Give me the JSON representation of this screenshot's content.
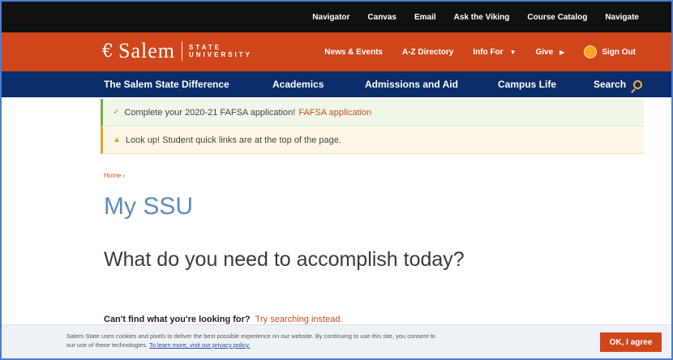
{
  "utility_nav": [
    "Navigator",
    "Canvas",
    "Email",
    "Ask the Viking",
    "Course Catalog",
    "Navigate"
  ],
  "brand": {
    "logo_mark": "€",
    "logo_word": "Salem",
    "logo_sub_top": "STATE",
    "logo_sub_bottom": "UNIVERSITY",
    "links": {
      "news": "News & Events",
      "directory": "A-Z Directory",
      "info_for": "Info For",
      "give": "Give",
      "sign_out": "Sign Out"
    },
    "color": "#d0461c"
  },
  "main_nav": {
    "difference": "The Salem State Difference",
    "academics": "Academics",
    "admissions": "Admissions and Aid",
    "campus_life": "Campus Life",
    "search": "Search",
    "color": "#0c2d6b"
  },
  "alerts": {
    "success_text": "Complete your 2020-21 FAFSA application!",
    "success_link": "FAFSA application",
    "warning_text": "Look up! Student quick links are at the top of the page."
  },
  "breadcrumb": "Home ›",
  "page_title": "My SSU",
  "subhead": "What do you need to accomplish today?",
  "search_hint": {
    "bold": "Can't find what you're looking for?",
    "link": "Try searching instead."
  },
  "cookie": {
    "text": "Salem State uses cookies and pixels to deliver the best possible experience on our website. By continuing to use this site, you consent to our use of these technologies.",
    "link": "To learn more, visit our privacy policy.",
    "button": "OK, I agree"
  }
}
